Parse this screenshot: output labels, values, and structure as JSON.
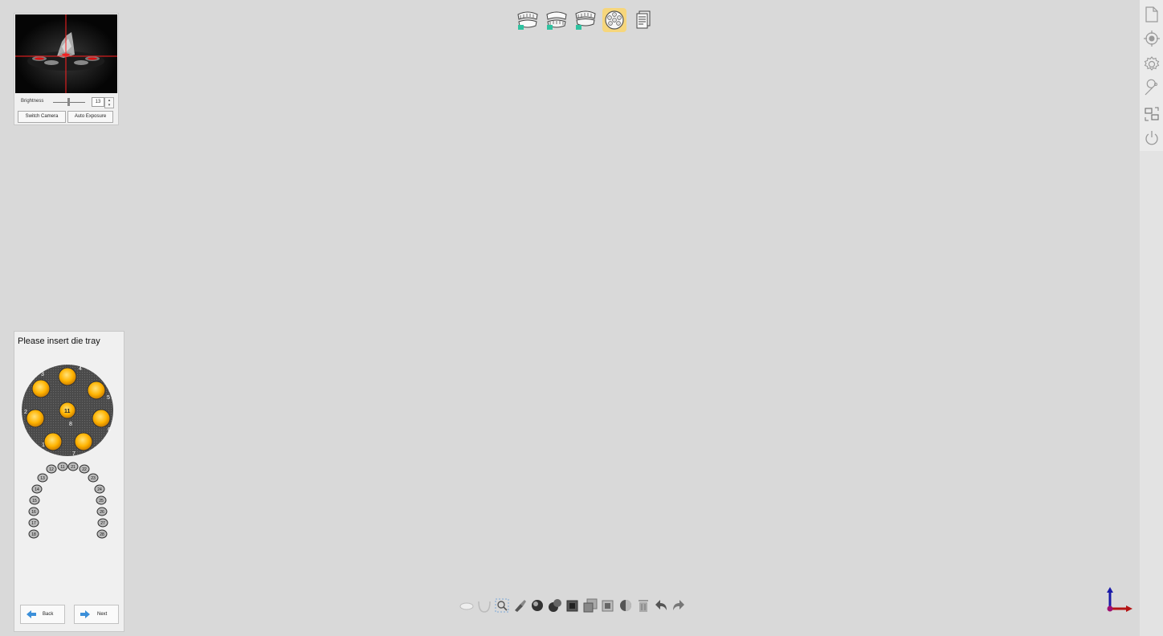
{
  "camera_panel": {
    "brightness_label": "Brightness",
    "brightness_value": "13",
    "switch_camera_label": "Switch Camera",
    "auto_exposure_label": "Auto Exposure"
  },
  "top_toolbar": {
    "items": [
      {
        "icon": "upper-jaw-scan-icon"
      },
      {
        "icon": "lower-jaw-scan-icon"
      },
      {
        "icon": "bite-scan-icon"
      },
      {
        "icon": "die-tray-scan-icon",
        "active": true
      },
      {
        "icon": "report-icon"
      }
    ]
  },
  "right_sidebar": {
    "items": [
      {
        "icon": "new-file-icon"
      },
      {
        "icon": "calibration-target-icon"
      },
      {
        "icon": "settings-icon"
      },
      {
        "icon": "tools-wrench-icon"
      },
      {
        "icon": "fit-view-icon"
      },
      {
        "icon": "power-icon"
      }
    ]
  },
  "tray_panel": {
    "title": "Please insert die tray",
    "tray_positions": [
      "1",
      "2",
      "3",
      "4",
      "5",
      "6",
      "7",
      "8",
      "11"
    ],
    "tooth_arch": {
      "top": [
        "12",
        "11",
        "21",
        "22"
      ],
      "left": [
        "13",
        "14",
        "15",
        "16",
        "17",
        "18"
      ],
      "right": [
        "23",
        "24",
        "25",
        "26",
        "27",
        "28"
      ]
    },
    "back_label": "Back",
    "next_label": "Next"
  },
  "bottom_toolbar": {
    "items": [
      {
        "icon": "upper-jaw-view-icon"
      },
      {
        "icon": "lower-jaw-view-icon"
      },
      {
        "icon": "zoom-select-icon"
      },
      {
        "icon": "brush-tool-icon"
      },
      {
        "icon": "fill-sphere-icon"
      },
      {
        "icon": "multi-sphere-icon"
      },
      {
        "icon": "cut-square-icon"
      },
      {
        "icon": "clone-square-icon"
      },
      {
        "icon": "layer-square-icon"
      },
      {
        "icon": "half-sphere-icon"
      },
      {
        "icon": "delete-icon"
      },
      {
        "icon": "undo-icon"
      },
      {
        "icon": "redo-icon"
      }
    ]
  },
  "colors": {
    "background": "#d9d9d9",
    "active_highlight": "#f6d67c",
    "tooth_yellow": "#ffb300",
    "tray_gray": "#4a4a4a",
    "scan_green": "#2ec2a0"
  }
}
